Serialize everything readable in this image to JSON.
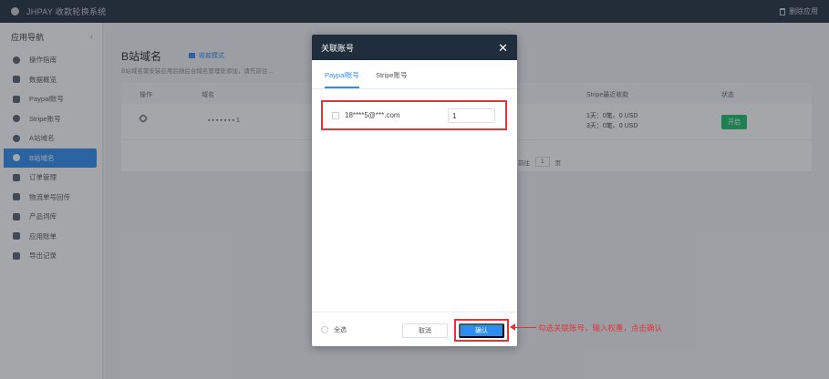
{
  "topbar": {
    "app_title": "JHPAY 收款轮换系统",
    "right_label": "删除应用"
  },
  "sidebar": {
    "header": "应用导航",
    "items": [
      {
        "label": "操作指南",
        "icon": "compass-icon"
      },
      {
        "label": "数据概览",
        "icon": "bar-chart-icon"
      },
      {
        "label": "Paypal账号",
        "icon": "paypal-icon"
      },
      {
        "label": "Stripe账号",
        "icon": "stripe-icon"
      },
      {
        "label": "A站域名",
        "icon": "a-site-icon"
      },
      {
        "label": "B站域名",
        "icon": "b-site-icon",
        "active": true
      },
      {
        "label": "订单管理",
        "icon": "order-icon"
      },
      {
        "label": "物流单号回传",
        "icon": "truck-icon"
      },
      {
        "label": "产品词库",
        "icon": "product-icon"
      },
      {
        "label": "应用账单",
        "icon": "bill-icon"
      },
      {
        "label": "导出记录",
        "icon": "download-icon"
      }
    ]
  },
  "page": {
    "title": "B站域名",
    "mode_label": "收款模式",
    "description": "B站域名需安装应用后随后台域名管理处添加，请先前往…",
    "columns": {
      "action": "操作",
      "domain": "域名",
      "stripe_recent": "Stripe最近收款",
      "status": "状态"
    },
    "row": {
      "domain": "▪ ▪ ▪ ▪ ▪ ▪ ▪ 1",
      "stat_line1": "1天：0笔、0 USD",
      "stat_line2": "3天：0笔、0 USD",
      "status": "开启"
    },
    "pager": {
      "goto": "前往",
      "page": "1",
      "unit": "页"
    }
  },
  "modal": {
    "title": "关联账号",
    "tabs": [
      "Paypal账号",
      "Stripe账号"
    ],
    "active_tab": 0,
    "account": {
      "email": "18****5@***.com",
      "quantity": "1"
    },
    "select_all": "全选",
    "cancel": "取消",
    "confirm": "确认"
  },
  "annotation": {
    "text": "勾选关联账号，输入权重，点击确认"
  }
}
